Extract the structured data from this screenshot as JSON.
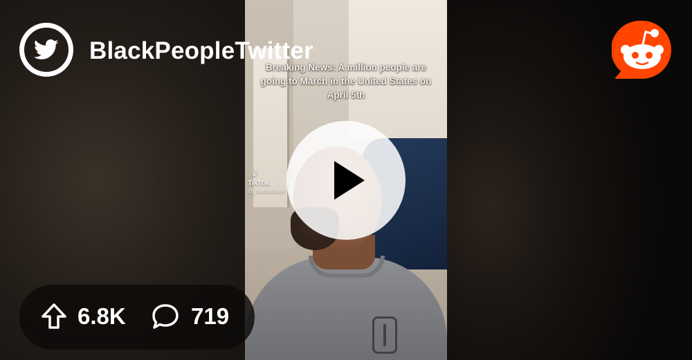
{
  "header": {
    "subreddit_name": "BlackPeopleTwitter",
    "subreddit_icon": "twitter-bird-icon",
    "brand_icon": "reddit-snoo-icon"
  },
  "video": {
    "caption": "Breaking News: A million people are going to March in the United States on April 5th",
    "watermark_brand": "TikTok",
    "watermark_handle": "@_bernardtayl",
    "play_icon": "play-icon"
  },
  "stats": {
    "upvotes": "6.8K",
    "upvote_icon": "upvote-arrow-icon",
    "comments": "719",
    "comment_icon": "comment-bubble-icon"
  },
  "colors": {
    "reddit_orange": "#FF4500",
    "text": "#FFFFFF",
    "pill_bg": "#0C0A09"
  }
}
